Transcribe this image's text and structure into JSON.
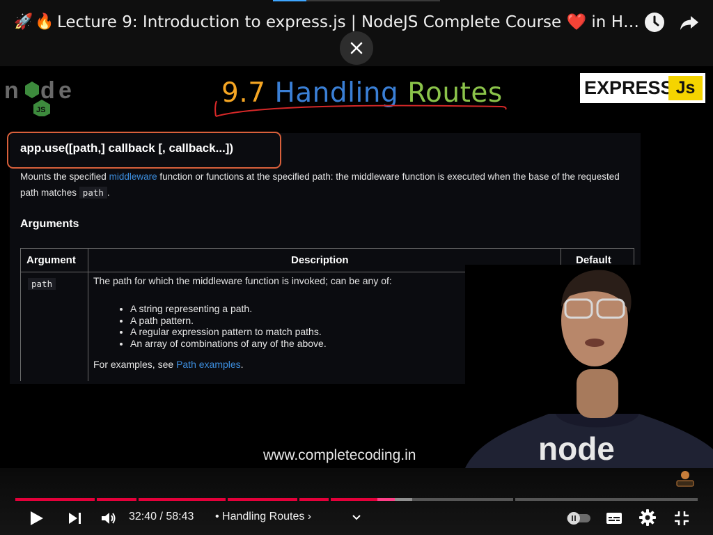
{
  "window": {
    "title_emojis": [
      "🚀",
      "🔥"
    ],
    "title": "Lecture 9: Introduction to express.js | NodeJS Complete Course",
    "title_heart": "❤️",
    "title_suffix": " in Hindi …",
    "icons": [
      "rocket-icon",
      "fire-icon",
      "clock-icon",
      "share-icon",
      "close-icon"
    ]
  },
  "slide": {
    "title_num": "9.7",
    "title_word1": "Handling",
    "title_word2": "Routes",
    "express_logo": "EXPRESS",
    "express_js": "Js",
    "signature": "app.use([path,] callback [, callback...])",
    "desc_part1": "Mounts the specified ",
    "desc_link": "middleware",
    "desc_part2": " function or functions at the specified path: the middleware function is executed when the base of the requested path matches ",
    "desc_code": "path",
    "desc_end": ".",
    "arguments_heading": "Arguments",
    "table": {
      "headers": [
        "Argument",
        "Description",
        "Default"
      ],
      "row_arg": "path",
      "row_desc": "The path for which the middleware function is invoked; can be any of:",
      "row_default": "'/'",
      "bullets": [
        "A string representing a path.",
        "A path pattern.",
        "A regular expression pattern to match paths.",
        "An array of combinations of any of the above."
      ],
      "examples_prefix": "For examples, see ",
      "examples_link": "Path examples",
      "examples_suffix": "."
    },
    "watermark": "www.completecoding.in"
  },
  "player": {
    "time": "32:40 / 58:43",
    "chapter": "• Handling Routes ›",
    "progress_fraction": 0.556,
    "colors": {
      "played": "#e4003a",
      "unplayed": "#555555",
      "buffered": "#909090"
    }
  }
}
